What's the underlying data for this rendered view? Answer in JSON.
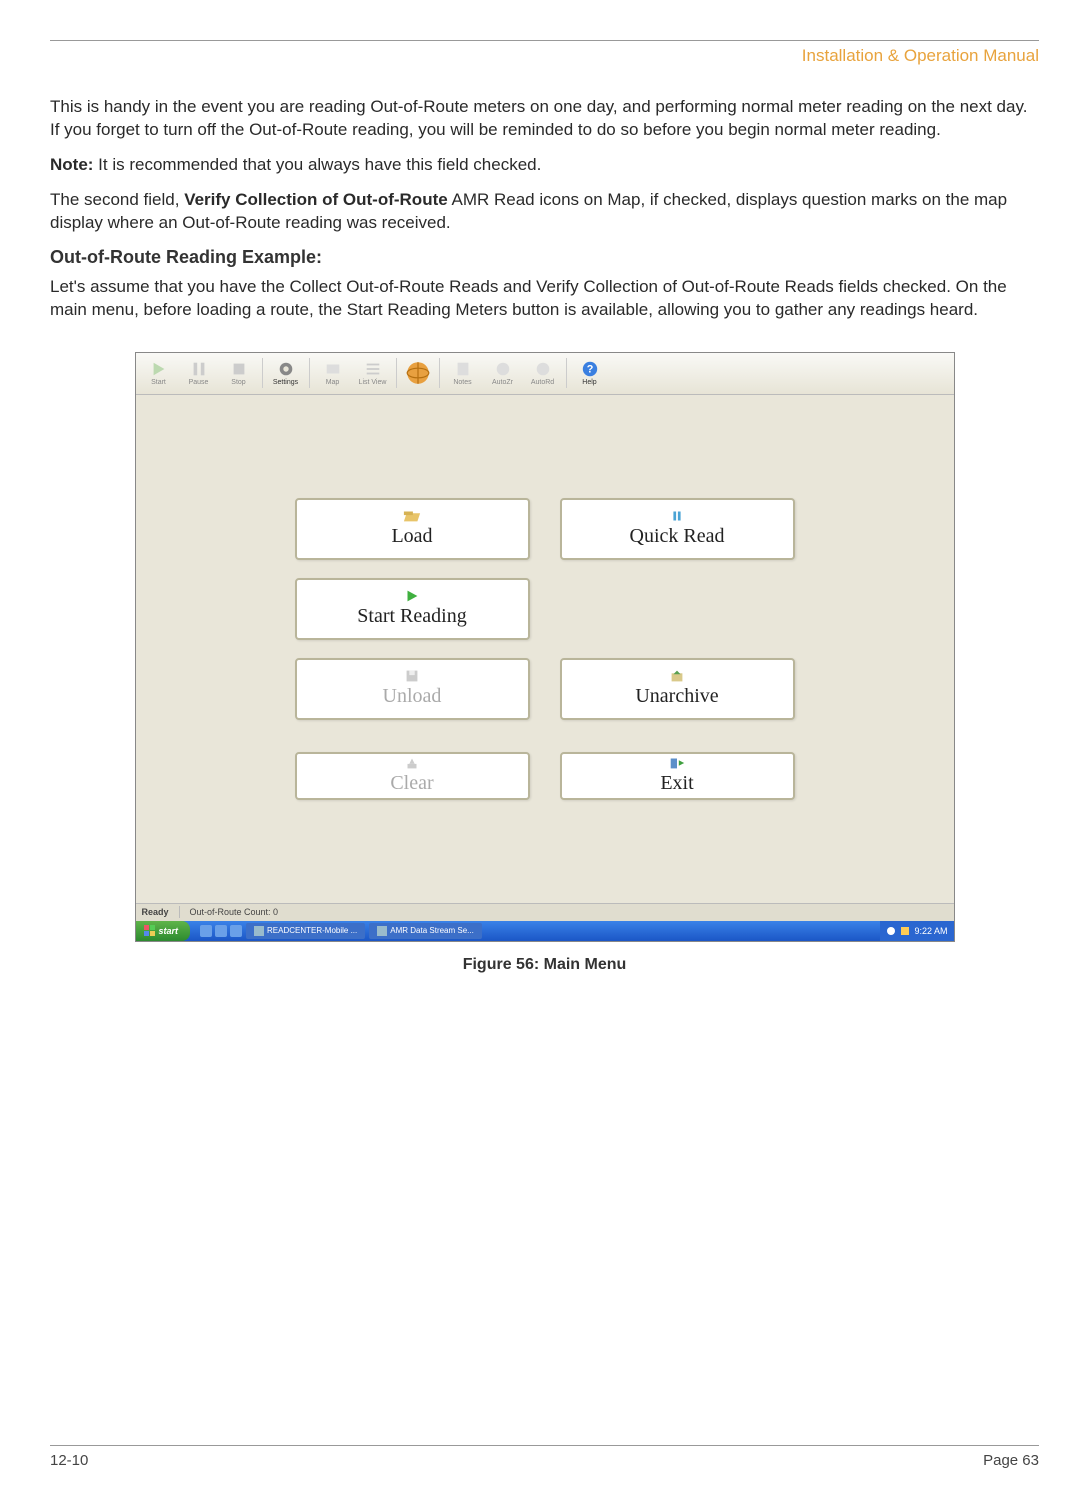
{
  "header": {
    "title": "Installation & Operation Manual"
  },
  "paragraphs": {
    "p1": " This is handy in the event you are reading Out-of-Route meters on one day, and performing normal meter reading on the next day.  If you forget to turn off the Out-of-Route reading, you will be reminded to do so before you begin normal meter reading.",
    "note_label": "Note:",
    "note_text": " It is recommended that you always have this field checked.",
    "p2_a": "The second field, ",
    "p2_bold": "Verify Collection of Out-of-Route",
    "p2_b": " AMR Read icons on Map, if checked, displays question marks on the map display where an Out-of-Route reading was received.",
    "heading": "Out-of-Route Reading Example:",
    "p3": "Let's assume that you have the Collect Out-of-Route Reads and Verify Collection of Out-of-Route Reads fields checked.  On the main menu, before loading a route, the Start Reading Meters button is available, allowing you to gather any readings heard."
  },
  "screenshot": {
    "toolbar": {
      "items": [
        {
          "label": "Start"
        },
        {
          "label": "Pause"
        },
        {
          "label": "Stop"
        },
        {
          "label": "Settings",
          "enabled": true
        },
        {
          "label": "Map"
        },
        {
          "label": "List View"
        },
        {
          "label": "",
          "globe": true,
          "enabled": true
        },
        {
          "label": "Notes"
        },
        {
          "label": "AutoZr"
        },
        {
          "label": "AutoRd"
        },
        {
          "label": "Help",
          "enabled": true,
          "help": true
        }
      ]
    },
    "buttons": {
      "load": "Load",
      "quick_read": "Quick Read",
      "start_reading": "Start Reading",
      "unload": "Unload",
      "unarchive": "Unarchive",
      "clear": "Clear",
      "exit": "Exit"
    },
    "status": {
      "ready": "Ready",
      "count": "Out-of-Route Count:  0"
    },
    "taskbar": {
      "start": "start",
      "task1": "READCENTER-Mobile ...",
      "task2": "AMR Data Stream Se...",
      "time": "9:22 AM"
    }
  },
  "figure_caption": "Figure 56: Main Menu",
  "footer": {
    "left": "12-10",
    "right": "Page 63"
  }
}
